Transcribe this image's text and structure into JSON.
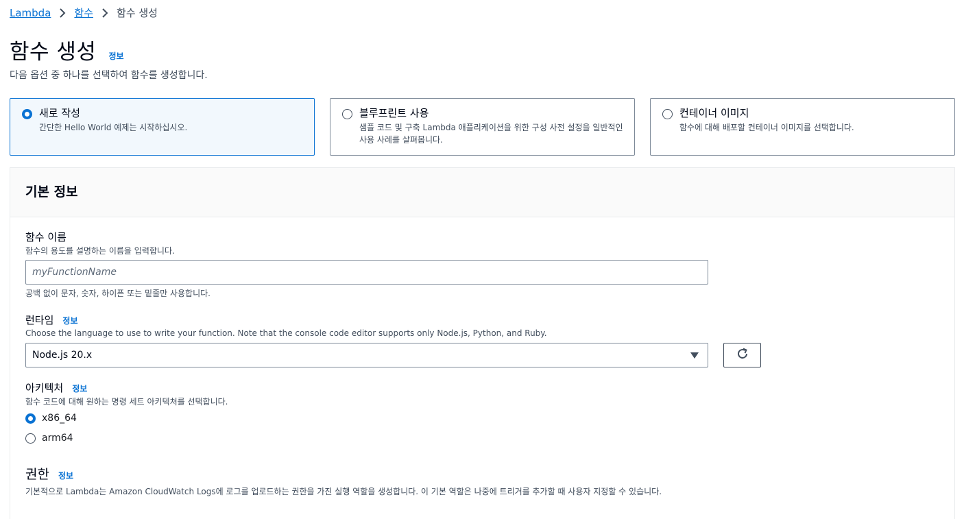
{
  "breadcrumb": {
    "items": [
      "Lambda",
      "함수"
    ],
    "current": "함수 생성"
  },
  "header": {
    "title": "함수 생성",
    "info": "정보",
    "description": "다음 옵션 중 하나를 선택하여 함수를 생성합니다."
  },
  "options": [
    {
      "title": "새로 작성",
      "desc": "간단한 Hello World 예제는 시작하십시오.",
      "selected": true
    },
    {
      "title": "블루프린트 사용",
      "desc": "샘플 코드 및 구축 Lambda 애플리케이션을 위한 구성 사전 설정을 일반적인 사용 사례를 살펴봅니다.",
      "selected": false
    },
    {
      "title": "컨테이너 이미지",
      "desc": "함수에 대해 배포할 컨테이너 이미지를 선택합니다.",
      "selected": false
    }
  ],
  "basic_info": {
    "title": "기본 정보",
    "function_name": {
      "label": "함수 이름",
      "description": "함수의 용도를 설명하는 이름을 입력합니다.",
      "placeholder": "myFunctionName",
      "value": "",
      "constraint": "공백 없이 문자, 숫자, 하이픈 또는 밑줄만 사용합니다."
    },
    "runtime": {
      "label": "런타임",
      "info": "정보",
      "description": "Choose the language to use to write your function. Note that the console code editor supports only Node.js, Python, and Ruby.",
      "selected": "Node.js 20.x"
    },
    "architecture": {
      "label": "아키텍처",
      "info": "정보",
      "description": "함수 코드에 대해 원하는 명령 세트 아키텍처를 선택합니다.",
      "options": [
        {
          "label": "x86_64",
          "selected": true
        },
        {
          "label": "arm64",
          "selected": false
        }
      ]
    },
    "permissions": {
      "label": "권한",
      "info": "정보",
      "description": "기본적으로 Lambda는 Amazon CloudWatch Logs에 로그를 업로드하는 권한을 가진 실행 역할을 생성합니다. 이 기본 역할은 나중에 트리거를 추가할 때 사용자 지정할 수 있습니다."
    }
  },
  "colors": {
    "accent": "#0972d3",
    "selected_bg": "#f2f8fd"
  }
}
